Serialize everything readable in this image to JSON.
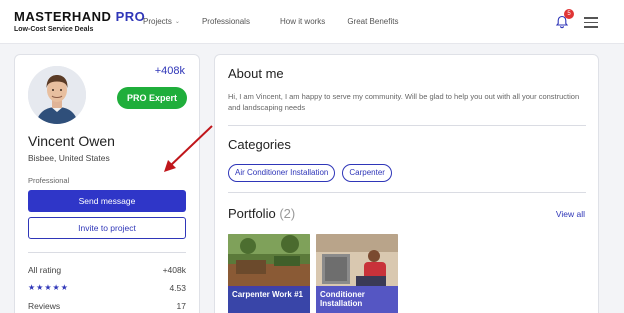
{
  "header": {
    "brand_name": "MASTERHAND",
    "brand_pro": "PRO",
    "brand_sub": "Low-Cost Service Deals",
    "nav": [
      {
        "label": "Projects",
        "has_dropdown": true
      },
      {
        "label": "Professionals",
        "has_dropdown": false
      },
      {
        "label": "How it works",
        "has_dropdown": false
      },
      {
        "label": "Great Benefits",
        "has_dropdown": false
      }
    ],
    "notifications_count": "5",
    "icons": {
      "bell": "bell-icon",
      "menu": "hamburger-menu-icon"
    }
  },
  "profile": {
    "rating_top": "+408k",
    "badge": "PRO  Expert",
    "name": "Vincent Owen",
    "location": "Bisbee, United States",
    "role": "Professional",
    "send_message": "Send message",
    "invite": "Invite to project",
    "stats": [
      {
        "label": "All rating",
        "value": "+408k"
      },
      {
        "label": "★★★★★",
        "value": "4.53"
      },
      {
        "label": "Reviews",
        "value": "17"
      }
    ]
  },
  "about": {
    "title": "About me",
    "text": "Hi, I am Vincent, I am happy to serve my community. Will be glad to help you out with all your construction and landscaping needs"
  },
  "categories": {
    "title": "Categories",
    "items": [
      "Air Conditioner Installation",
      "Carpenter"
    ]
  },
  "portfolio": {
    "title": "Portfolio",
    "count": "(2)",
    "view_all": "View all",
    "items": [
      {
        "label": "Carpenter Work #1"
      },
      {
        "label": "Conditioner Installation"
      }
    ]
  },
  "colors": {
    "accent": "#2f36b8",
    "primary_button": "#2f36c8",
    "pro_badge": "#1fae3b",
    "notification": "#e03535",
    "annotation_arrow": "#c0161b"
  }
}
